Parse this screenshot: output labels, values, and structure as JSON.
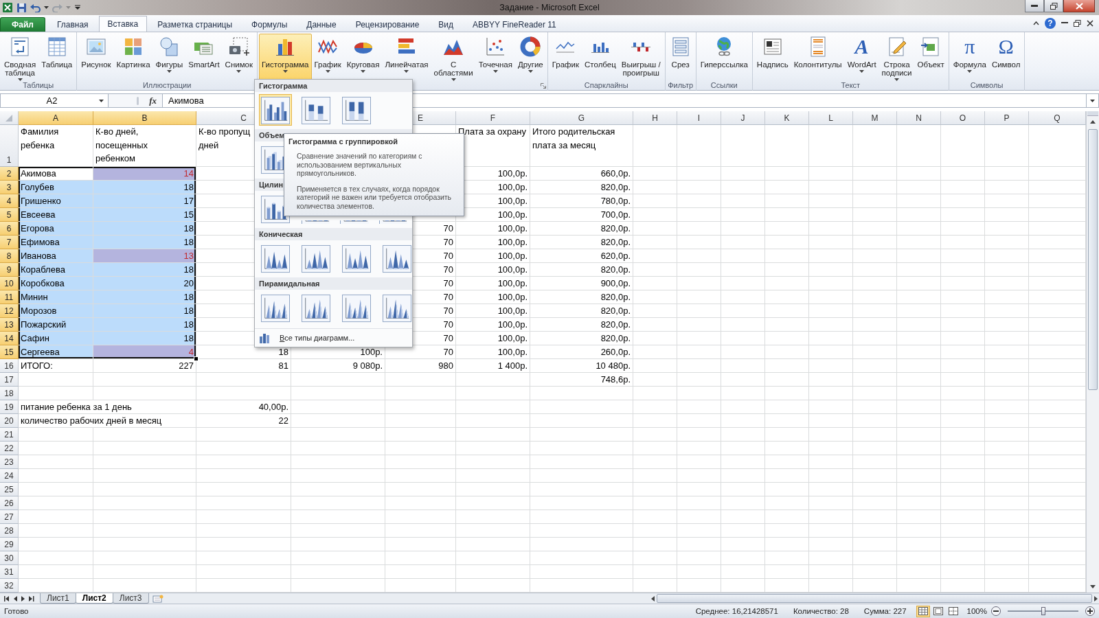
{
  "window": {
    "title": "Задание - Microsoft Excel",
    "help": "?"
  },
  "ribbon_tabs": [
    {
      "label": "Файл",
      "kind": "file",
      "selected": false
    },
    {
      "label": "Главная",
      "kind": "tab",
      "selected": false
    },
    {
      "label": "Вставка",
      "kind": "tab",
      "selected": true
    },
    {
      "label": "Разметка страницы",
      "kind": "tab",
      "selected": false
    },
    {
      "label": "Формулы",
      "kind": "tab",
      "selected": false
    },
    {
      "label": "Данные",
      "kind": "tab",
      "selected": false
    },
    {
      "label": "Рецензирование",
      "kind": "tab",
      "selected": false
    },
    {
      "label": "Вид",
      "kind": "tab",
      "selected": false
    },
    {
      "label": "ABBYY FineReader 11",
      "kind": "tab",
      "selected": false
    }
  ],
  "ribbon_groups": [
    {
      "label": "Таблицы",
      "launcher": false,
      "buttons": [
        {
          "label": "Сводная\nтаблица",
          "kind": "pivot",
          "dropdown": true,
          "selected": false
        },
        {
          "label": "Таблица",
          "kind": "table",
          "dropdown": false,
          "selected": false
        }
      ]
    },
    {
      "label": "Иллюстрации",
      "launcher": false,
      "buttons": [
        {
          "label": "Рисунок",
          "kind": "picture",
          "dropdown": false,
          "selected": false
        },
        {
          "label": "Картинка",
          "kind": "clipart",
          "dropdown": false,
          "selected": false
        },
        {
          "label": "Фигуры",
          "kind": "shapes",
          "dropdown": true,
          "selected": false
        },
        {
          "label": "SmartArt",
          "kind": "smartart",
          "dropdown": false,
          "selected": false
        },
        {
          "label": "Снимок",
          "kind": "screenshot",
          "dropdown": true,
          "selected": false
        }
      ]
    },
    {
      "launcher": true,
      "buttons": [
        {
          "label": "Гистограмма",
          "kind": "column",
          "dropdown": true,
          "selected": true
        },
        {
          "label": "График",
          "kind": "line",
          "dropdown": true,
          "selected": false
        },
        {
          "label": "Круговая",
          "kind": "pie",
          "dropdown": true,
          "selected": false
        },
        {
          "label": "Линейчатая",
          "kind": "bar",
          "dropdown": true,
          "selected": false
        },
        {
          "label": "С\nобластями",
          "kind": "area",
          "dropdown": true,
          "selected": false
        },
        {
          "label": "Точечная",
          "kind": "scatter",
          "dropdown": true,
          "selected": false
        },
        {
          "label": "Другие",
          "kind": "donut",
          "dropdown": true,
          "selected": false
        }
      ]
    },
    {
      "label": "Спарклайны",
      "launcher": false,
      "buttons": [
        {
          "label": "График",
          "kind": "spark_line",
          "dropdown": false,
          "selected": false
        },
        {
          "label": "Столбец",
          "kind": "spark_column",
          "dropdown": false,
          "selected": false
        },
        {
          "label": "Выигрыш /\nпроигрыш",
          "kind": "spark_winloss",
          "dropdown": false,
          "selected": false
        }
      ]
    },
    {
      "label": "Фильтр",
      "launcher": false,
      "buttons": [
        {
          "label": "Срез",
          "kind": "slicer",
          "dropdown": false,
          "selected": false
        }
      ]
    },
    {
      "label": "Ссылки",
      "launcher": false,
      "buttons": [
        {
          "label": "Гиперссылка",
          "kind": "hyperlink",
          "dropdown": false,
          "selected": false
        }
      ]
    },
    {
      "label": "Текст",
      "launcher": false,
      "buttons": [
        {
          "label": "Надпись",
          "kind": "textbox",
          "dropdown": false,
          "selected": false
        },
        {
          "label": "Колонтитулы",
          "kind": "header_footer",
          "dropdown": false,
          "selected": false
        },
        {
          "label": "WordArt",
          "kind": "glyph",
          "glyph": "A",
          "dropdown": true,
          "selected": false
        },
        {
          "label": "Строка\nподписи",
          "kind": "signature",
          "dropdown": true,
          "selected": false
        },
        {
          "label": "Объект",
          "kind": "object",
          "dropdown": false,
          "selected": false
        }
      ]
    },
    {
      "label": "Символы",
      "launcher": false,
      "buttons": [
        {
          "label": "Формула",
          "kind": "glyph",
          "glyph": "π",
          "dropdown": true,
          "selected": false
        },
        {
          "label": "Символ",
          "kind": "glyph",
          "glyph": "Ω",
          "dropdown": false,
          "selected": false
        }
      ]
    }
  ],
  "formula_bar": {
    "name_box": "A2",
    "fx": "fx",
    "value": "Акимова"
  },
  "grid": {
    "columns": [
      {
        "label": "A",
        "selected": true,
        "active": true,
        "conditional": false
      },
      {
        "label": "B",
        "selected": true,
        "active": false,
        "conditional": true
      },
      {
        "label": "C",
        "selected": false,
        "active": false,
        "conditional": false
      },
      {},
      {
        "label": "E",
        "selected": false,
        "active": false,
        "conditional": false
      },
      {
        "label": "F",
        "selected": false,
        "active": false,
        "conditional": false
      },
      {
        "label": "G",
        "selected": false,
        "active": false,
        "conditional": false
      },
      {
        "label": "H",
        "selected": false,
        "active": false,
        "conditional": false
      },
      {
        "label": "I",
        "selected": false,
        "active": false,
        "conditional": false
      },
      {
        "label": "J",
        "selected": false,
        "active": false,
        "conditional": false
      },
      {
        "label": "K",
        "selected": false,
        "active": false,
        "conditional": false
      },
      {
        "label": "L",
        "selected": false,
        "active": false,
        "conditional": false
      },
      {
        "label": "M",
        "selected": false,
        "active": false,
        "conditional": false
      },
      {
        "label": "N",
        "selected": false,
        "active": false,
        "conditional": false
      },
      {
        "label": "O",
        "selected": false,
        "active": false,
        "conditional": false
      },
      {
        "label": "P",
        "selected": false,
        "active": false,
        "conditional": false
      },
      {
        "label": "Q",
        "selected": false,
        "active": false,
        "conditional": false
      }
    ],
    "rows": [
      {
        "number": "1",
        "kind": "header",
        "selected": false,
        "active": false,
        "flagged": false,
        "cells": [
          "Фамилия\nребенка",
          "К-во дней,\nпосещенных\nребенком",
          "К-во пропущ\nдней",
          null,
          null,
          "Плата за охрану",
          "Итого родительская\nплата за месяц"
        ]
      },
      {
        "number": "2",
        "kind": "data",
        "selected": true,
        "active": true,
        "flagged": true,
        "cells": [
          "Акимова",
          "14",
          null,
          null,
          null,
          "100,0р.",
          "660,0р."
        ]
      },
      {
        "number": "3",
        "kind": "data",
        "selected": true,
        "active": false,
        "flagged": false,
        "cells": [
          "Голубев",
          "18",
          null,
          null,
          null,
          "100,0р.",
          "820,0р."
        ]
      },
      {
        "number": "4",
        "kind": "data",
        "selected": true,
        "active": false,
        "flagged": false,
        "cells": [
          "Гришенко",
          "17",
          null,
          null,
          null,
          "100,0р.",
          "780,0р."
        ]
      },
      {
        "number": "5",
        "kind": "data",
        "selected": true,
        "active": false,
        "flagged": false,
        "cells": [
          "Евсеева",
          "15",
          null,
          null,
          null,
          "100,0р.",
          "700,0р."
        ]
      },
      {
        "number": "6",
        "kind": "data",
        "selected": true,
        "active": false,
        "flagged": false,
        "cells": [
          "Егорова",
          "18",
          null,
          null,
          "70",
          "100,0р.",
          "820,0р."
        ]
      },
      {
        "number": "7",
        "kind": "data",
        "selected": true,
        "active": false,
        "flagged": false,
        "cells": [
          "Ефимова",
          "18",
          null,
          null,
          "70",
          "100,0р.",
          "820,0р."
        ]
      },
      {
        "number": "8",
        "kind": "data",
        "selected": true,
        "active": false,
        "flagged": true,
        "cells": [
          "Иванова",
          "13",
          null,
          null,
          "70",
          "100,0р.",
          "620,0р."
        ]
      },
      {
        "number": "9",
        "kind": "data",
        "selected": true,
        "active": false,
        "flagged": false,
        "cells": [
          "Кораблева",
          "18",
          null,
          null,
          "70",
          "100,0р.",
          "820,0р."
        ]
      },
      {
        "number": "10",
        "kind": "data",
        "selected": true,
        "active": false,
        "flagged": false,
        "cells": [
          "Коробкова",
          "20",
          null,
          null,
          "70",
          "100,0р.",
          "900,0р."
        ]
      },
      {
        "number": "11",
        "kind": "data",
        "selected": true,
        "active": false,
        "flagged": false,
        "cells": [
          "Минин",
          "18",
          null,
          null,
          "70",
          "100,0р.",
          "820,0р."
        ]
      },
      {
        "number": "12",
        "kind": "data",
        "selected": true,
        "active": false,
        "flagged": false,
        "cells": [
          "Морозов",
          "18",
          null,
          null,
          "70",
          "100,0р.",
          "820,0р."
        ]
      },
      {
        "number": "13",
        "kind": "data",
        "selected": true,
        "active": false,
        "flagged": false,
        "cells": [
          "Пожарский",
          "18",
          null,
          null,
          "70",
          "100,0р.",
          "820,0р."
        ]
      },
      {
        "number": "14",
        "kind": "data",
        "selected": true,
        "active": false,
        "flagged": false,
        "cells": [
          "Сафин",
          "18",
          null,
          null,
          "70",
          "100,0р.",
          "820,0р."
        ]
      },
      {
        "number": "15",
        "kind": "data",
        "selected": true,
        "active": false,
        "flagged": true,
        "cells": [
          "Сергеева",
          "4",
          "18",
          "100р.",
          "70",
          "100,0р.",
          "260,0р."
        ]
      },
      {
        "number": "16",
        "kind": "data",
        "selected": false,
        "active": false,
        "flagged": false,
        "cells": [
          "ИТОГО:",
          "227",
          "81",
          "9 080р.",
          "980",
          "1 400р.",
          "10 480р."
        ]
      },
      {
        "number": "17",
        "kind": "data",
        "selected": false,
        "active": false,
        "flagged": false,
        "cells": [
          null,
          null,
          null,
          null,
          null,
          null,
          "748,6р."
        ]
      },
      {
        "number": "18",
        "kind": "data",
        "selected": false,
        "active": false,
        "flagged": false
      },
      {
        "number": "19",
        "kind": "data",
        "selected": false,
        "active": false,
        "flagged": false,
        "cells": [
          "питание ребенка за 1 день",
          null,
          "40,00р."
        ]
      },
      {
        "number": "20",
        "kind": "data",
        "selected": false,
        "active": false,
        "flagged": false,
        "cells": [
          "количество рабочих дней в месяц",
          null,
          "22"
        ]
      },
      {
        "number": "21",
        "kind": "data",
        "selected": false,
        "active": false,
        "flagged": false
      },
      {
        "number": "22",
        "kind": "data",
        "selected": false,
        "active": false,
        "flagged": false
      },
      {
        "number": "23",
        "kind": "data",
        "selected": false,
        "active": false,
        "flagged": false
      },
      {
        "number": "24",
        "kind": "data",
        "selected": false,
        "active": false,
        "flagged": false
      },
      {
        "number": "25",
        "kind": "data",
        "selected": false,
        "active": false,
        "flagged": false
      },
      {
        "number": "26",
        "kind": "data",
        "selected": false,
        "active": false,
        "flagged": false
      },
      {
        "number": "27",
        "kind": "data",
        "selected": false,
        "active": false,
        "flagged": false
      },
      {
        "number": "28",
        "kind": "data",
        "selected": false,
        "active": false,
        "flagged": false
      },
      {
        "number": "29",
        "kind": "data",
        "selected": false,
        "active": false,
        "flagged": false
      },
      {
        "number": "30",
        "kind": "data",
        "selected": false,
        "active": false,
        "flagged": false
      },
      {
        "number": "31",
        "kind": "data",
        "selected": false,
        "active": false,
        "flagged": false
      },
      {
        "number": "32",
        "kind": "data",
        "selected": false,
        "active": false,
        "flagged": false
      }
    ]
  },
  "chart_menu": {
    "sections": [
      {
        "title": "Гистограмма",
        "kind": "column",
        "items": [
          {
            "selected": true
          },
          {
            "selected": false
          },
          {
            "selected": false
          }
        ]
      },
      {
        "title": "Объем",
        "kind": "column3d",
        "items": [
          {
            "selected": false
          }
        ]
      },
      {
        "title": "Цилин",
        "kind": "cylinder",
        "items": [
          {
            "selected": false
          },
          {
            "selected": false
          },
          {
            "selected": false
          },
          {
            "selected": false
          }
        ]
      },
      {
        "title": "Коническая",
        "kind": "cone",
        "items": [
          {
            "selected": false
          },
          {
            "selected": false
          },
          {
            "selected": false
          },
          {
            "selected": false
          }
        ]
      },
      {
        "title": "Пирамидальная",
        "kind": "pyramid",
        "items": [
          {
            "selected": false
          },
          {
            "selected": false
          },
          {
            "selected": false
          },
          {
            "selected": false
          }
        ]
      }
    ],
    "footer": "Все типы диаграмм..."
  },
  "tooltip": {
    "title": "Гистограмма с группировкой",
    "paragraphs": [
      "Сравнение значений по категориям с использованием вертикальных прямоугольников.",
      "Применяется в тех случаях, когда порядок категорий не важен или требуется отобразить количества элементов."
    ]
  },
  "sheet_tabs": [
    {
      "label": "Лист1",
      "selected": false
    },
    {
      "label": "Лист2",
      "selected": true
    },
    {
      "label": "Лист3",
      "selected": false
    }
  ],
  "status_bar": {
    "ready": "Готово",
    "stats": [
      "Среднее: 16,21428571",
      "Количество: 28",
      "Сумма: 227"
    ],
    "views": [
      {
        "kind": "normal",
        "selected": true
      },
      {
        "kind": "layout",
        "selected": false
      },
      {
        "kind": "pagebreak",
        "selected": false
      }
    ],
    "zoom": {
      "label": "100%",
      "level": 0.5
    }
  }
}
